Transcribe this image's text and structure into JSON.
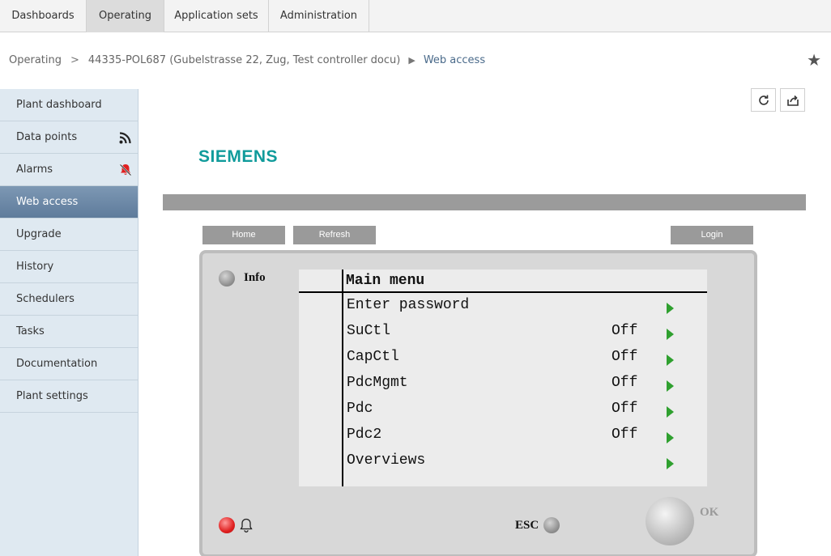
{
  "top_tabs": [
    {
      "label": "Dashboards"
    },
    {
      "label": "Operating"
    },
    {
      "label": "Application sets"
    },
    {
      "label": "Administration"
    }
  ],
  "breadcrumb": {
    "root": "Operating",
    "separator": ">",
    "plant": "44335-POL687 (Gubelstrasse 22, Zug, Test controller docu)",
    "arrow": "▶",
    "current": "Web access"
  },
  "sidebar": {
    "items": [
      {
        "label": "Plant dashboard"
      },
      {
        "label": "Data points",
        "icon": "rss-icon"
      },
      {
        "label": "Alarms",
        "icon": "alarm-bell-off-icon"
      },
      {
        "label": "Web access",
        "active": true
      },
      {
        "label": "Upgrade"
      },
      {
        "label": "History"
      },
      {
        "label": "Schedulers"
      },
      {
        "label": "Tasks"
      },
      {
        "label": "Documentation"
      },
      {
        "label": "Plant settings"
      }
    ]
  },
  "actions": {
    "refresh_icon": "refresh-icon",
    "export_icon": "export-icon"
  },
  "web_access": {
    "logo": "SIEMENS",
    "buttons": {
      "home": "Home",
      "refresh": "Refresh",
      "login": "Login"
    },
    "device": {
      "info_label": "Info",
      "esc_label": "ESC",
      "ok_label": "OK",
      "menu_title": "Main menu",
      "menu_items": [
        {
          "label": "Enter password",
          "value": ""
        },
        {
          "label": "SuCtl",
          "value": "Off"
        },
        {
          "label": "CapCtl",
          "value": "Off"
        },
        {
          "label": "PdcMgmt",
          "value": "Off"
        },
        {
          "label": "Pdc",
          "value": "Off"
        },
        {
          "label": "Pdc2",
          "value": "Off"
        },
        {
          "label": "Overviews",
          "value": ""
        }
      ]
    }
  },
  "colors": {
    "brand": "#109b9b",
    "sidebar_active": "#6a86a4",
    "alarm_red": "#e02020",
    "arrow_green": "#2fa02f"
  }
}
